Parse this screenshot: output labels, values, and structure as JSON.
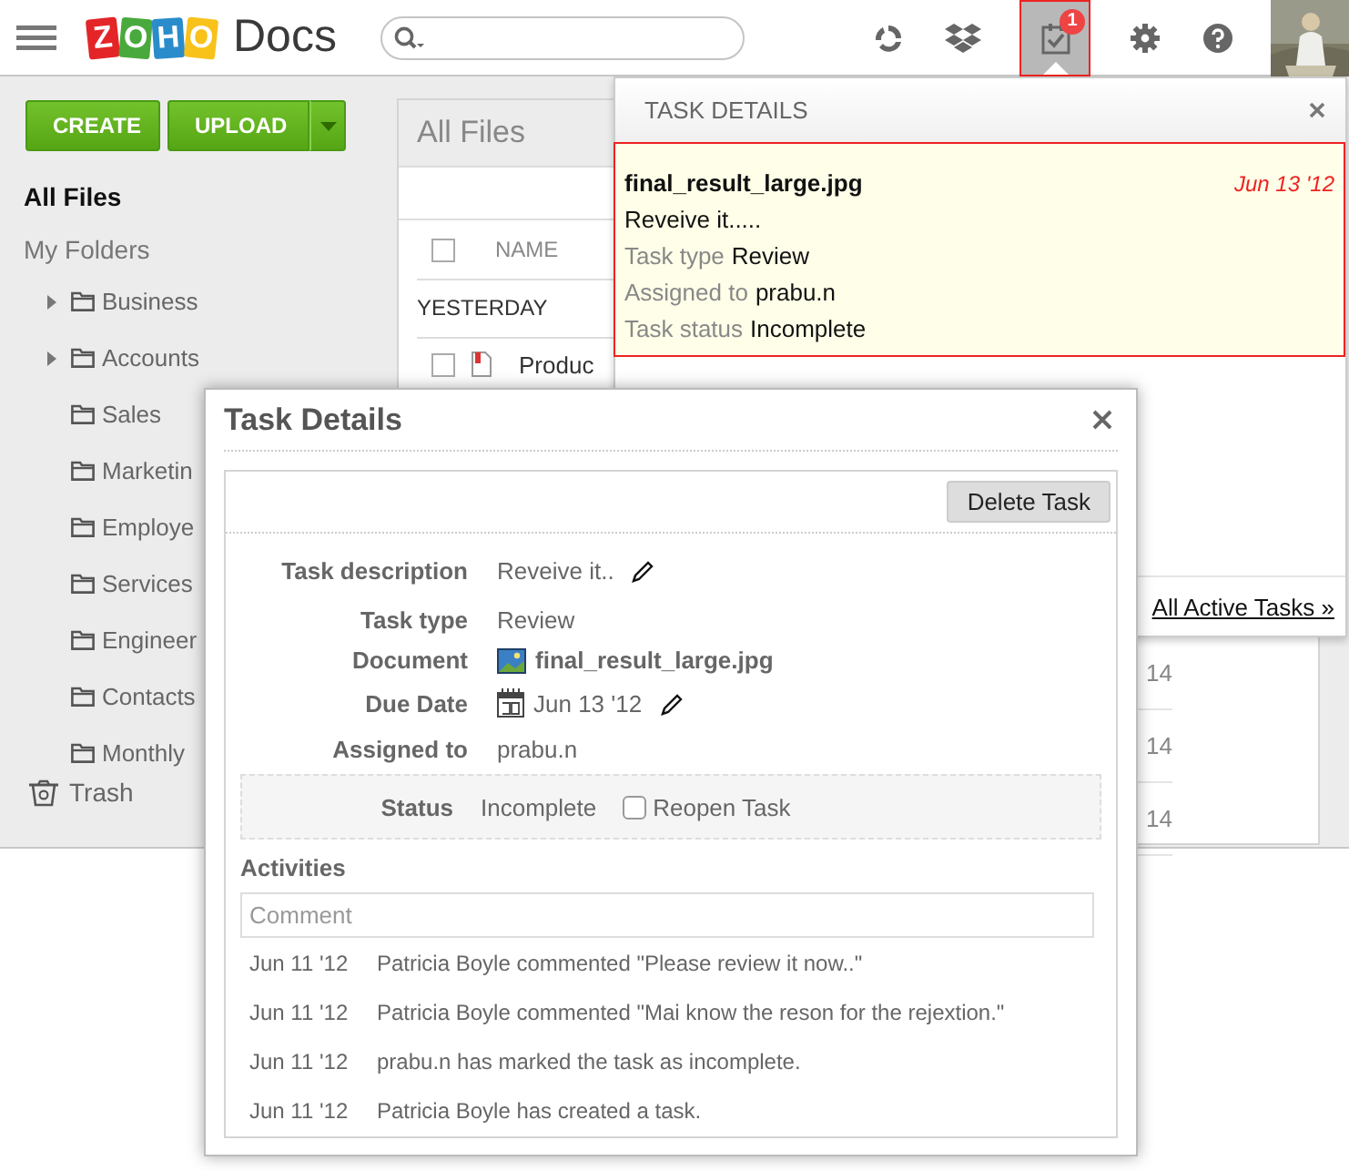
{
  "header": {
    "logo": {
      "letters": [
        {
          "char": "Z",
          "color": "#e42527"
        },
        {
          "char": "O",
          "color": "#4aa93c"
        },
        {
          "char": "H",
          "color": "#2a8ccb"
        },
        {
          "char": "O",
          "color": "#f8c21b"
        }
      ],
      "product": "Docs"
    },
    "task_badge": "1",
    "task_menu_open": true
  },
  "sidebar": {
    "create": "CREATE",
    "upload": "UPLOAD",
    "all_files": "All Files",
    "my_folders": "My Folders",
    "folders": [
      {
        "name": "Business",
        "expandable": true
      },
      {
        "name": "Accounts",
        "expandable": true
      },
      {
        "name": "Sales",
        "expandable": false
      },
      {
        "name": "Marketin",
        "expandable": false
      },
      {
        "name": "Employe",
        "expandable": false
      },
      {
        "name": "Services",
        "expandable": false
      },
      {
        "name": "Engineer",
        "expandable": false
      },
      {
        "name": "Contacts",
        "expandable": false
      },
      {
        "name": "Monthly",
        "expandable": false
      }
    ],
    "trash": "Trash"
  },
  "files": {
    "title": "All Files",
    "column": "NAME",
    "select_all": {
      "checked": false
    },
    "group": "YESTERDAY",
    "rows": [
      {
        "name": "Produc",
        "checked": false
      }
    ],
    "dates": [
      "14",
      "14",
      "14"
    ]
  },
  "task_panel": {
    "title": "TASK DETAILS",
    "task": {
      "file": "final_result_large.jpg",
      "due": "Jun 13 '12",
      "description": "Reveive it.....",
      "fields": [
        {
          "label": "Task type",
          "value": "Review"
        },
        {
          "label": "Assigned to",
          "value": "prabu.n"
        },
        {
          "label": "Task status",
          "value": "Incomplete"
        }
      ]
    },
    "link": "All Active Tasks »"
  },
  "modal": {
    "title": "Task Details",
    "delete": "Delete Task",
    "rows": [
      {
        "label": "Task description",
        "value": "Reveive it..",
        "kind": "editable"
      },
      {
        "label": "Task type",
        "value": "Review",
        "kind": "text"
      },
      {
        "label": "Document",
        "value": "final_result_large.jpg",
        "kind": "document"
      },
      {
        "label": "Due Date",
        "value": "Jun 13 '12",
        "kind": "date"
      },
      {
        "label": "Assigned to",
        "value": "prabu.n",
        "kind": "text"
      }
    ],
    "status": {
      "label": "Status",
      "value": "Incomplete",
      "reopen": {
        "label": "Reopen Task",
        "checked": false
      }
    },
    "activities_title": "Activities",
    "comment": {
      "placeholder": "Comment"
    },
    "activities": [
      {
        "date": "Jun 11 '12",
        "text": "Patricia Boyle commented \"Please review it now..\""
      },
      {
        "date": "Jun 11 '12",
        "text": "Patricia Boyle commented \"Mai know the reson for the rejextion.\""
      },
      {
        "date": "Jun 11 '12",
        "text": "prabu.n has marked the task as incomplete."
      },
      {
        "date": "Jun 11 '12",
        "text": "Patricia Boyle has created a task."
      }
    ]
  }
}
